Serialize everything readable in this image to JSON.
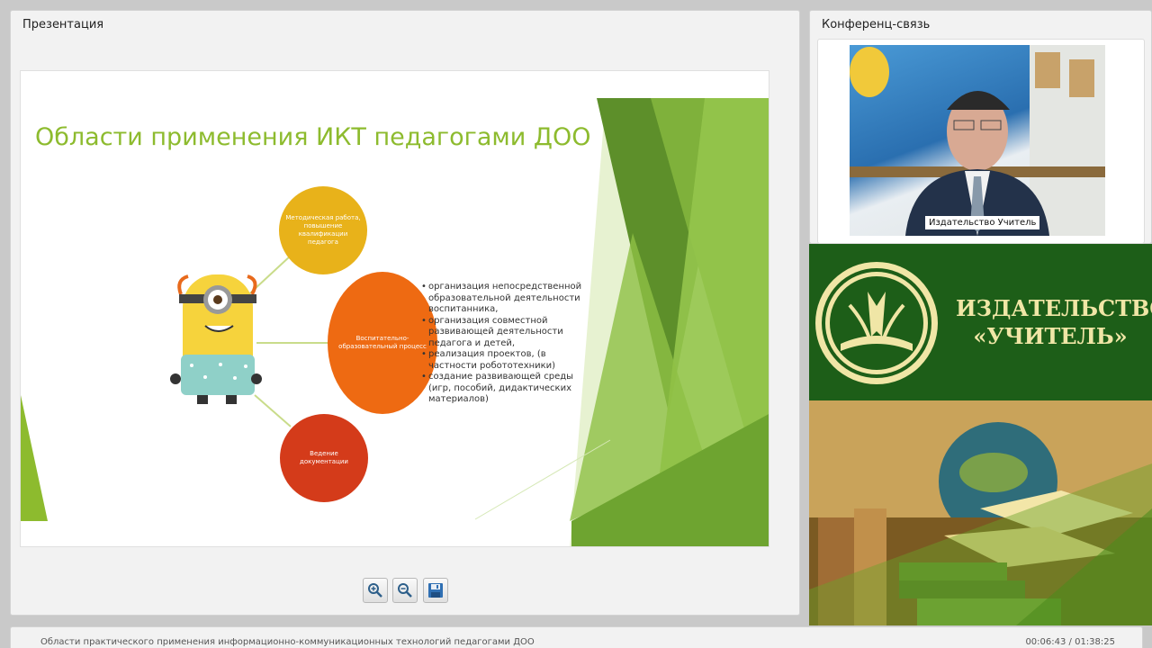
{
  "presentation_panel": {
    "title": "Презентация"
  },
  "slide": {
    "title": "Области применения ИКТ педагогами ДОО",
    "circles": [
      {
        "text": "Методическая работа, повышение квалификации педагога",
        "color": "#e8b21a"
      },
      {
        "text": "Воспитательно-образовательный процесс",
        "color": "#ee6a12"
      },
      {
        "text": "Ведение документации",
        "color": "#d43b1a"
      }
    ],
    "bullets": [
      "организация непосредственной образовательной деятельности воспитанника,",
      "организация совместной развивающей деятельности педагога и детей,",
      "реализация проектов, (в частности робототехники)",
      "создание развивающей среды (игр, пособий, дидактических материалов)"
    ],
    "accent_color": "#8dbb2e"
  },
  "toolbar": {
    "zoom_in_icon": "zoom-in-icon",
    "zoom_out_icon": "zoom-out-icon",
    "save_icon": "save-icon"
  },
  "conference_panel": {
    "title": "Конференц-связь",
    "video_label": "Издательство Учитель"
  },
  "ad": {
    "brand_line1": "ИЗДАТЕЛЬСТВО",
    "brand_line2": "«УЧИТЕЛЬ»",
    "background_color": "#1d5e18"
  },
  "status_bar": {
    "title": "Области практического применения информационно-коммуникационных технологий педагогами ДОО",
    "time": "00:06:43 / 01:38:25"
  }
}
